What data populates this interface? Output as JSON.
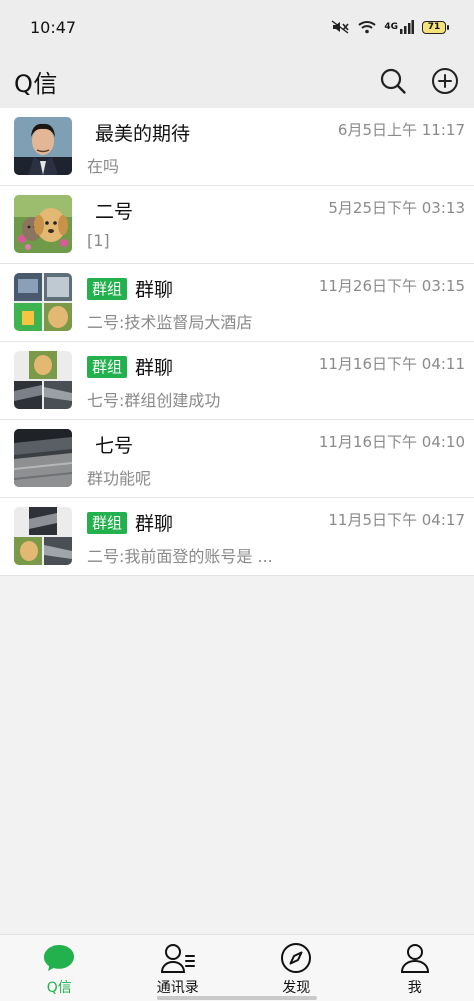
{
  "status_bar": {
    "time": "10:47",
    "network": "4G",
    "battery": "71"
  },
  "header": {
    "title": "Q信",
    "icons": [
      "search-icon",
      "add-icon"
    ]
  },
  "chats": [
    {
      "name": "最美的期待",
      "time": "6月5日上午 11:17",
      "preview": "在吗",
      "is_group": false
    },
    {
      "name": "二号",
      "time": "5月25日下午 03:13",
      "preview": "[1]",
      "is_group": false
    },
    {
      "name": "群聊",
      "tag": "群组",
      "time": "11月26日下午 03:15",
      "preview": "二号:技术监督局大酒店",
      "is_group": true
    },
    {
      "name": "群聊",
      "tag": "群组",
      "time": "11月16日下午 04:11",
      "preview": "七号:群组创建成功",
      "is_group": true
    },
    {
      "name": "七号",
      "time": "11月16日下午 04:10",
      "preview": "群功能呢",
      "is_group": false
    },
    {
      "name": "群聊",
      "tag": "群组",
      "time": "11月5日下午 04:17",
      "preview": "二号:我前面登的账号是 ...",
      "is_group": true
    }
  ],
  "tabs": [
    {
      "label": "Q信",
      "icon": "chat-bubble-icon",
      "active": true
    },
    {
      "label": "通讯录",
      "icon": "contacts-icon",
      "active": false
    },
    {
      "label": "发现",
      "icon": "compass-icon",
      "active": false
    },
    {
      "label": "我",
      "icon": "person-icon",
      "active": false
    }
  ],
  "colors": {
    "accent": "#22b14c",
    "header_bg": "#ededed",
    "list_bg": "#f2f2f2"
  }
}
